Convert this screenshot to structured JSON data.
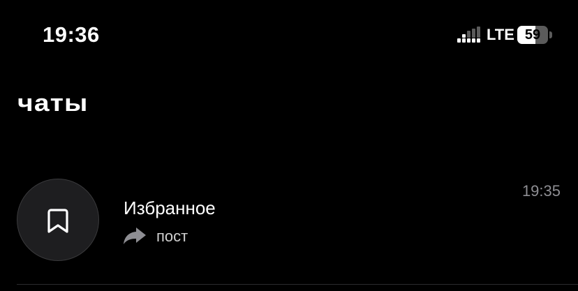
{
  "status_bar": {
    "time": "19:36",
    "network": "LTE",
    "battery_level": "59",
    "battery_fraction": 0.59
  },
  "header": {
    "title": "чаты"
  },
  "chats": [
    {
      "name": "Избранное",
      "time": "19:35",
      "preview": "пост",
      "avatar_icon": "bookmark-icon",
      "preview_icon": "forward-arrow-icon"
    }
  ],
  "colors": {
    "background": "#000000",
    "text": "#ffffff",
    "secondary_text": "#8e8e93",
    "avatar_bg": "#1e1e20"
  }
}
